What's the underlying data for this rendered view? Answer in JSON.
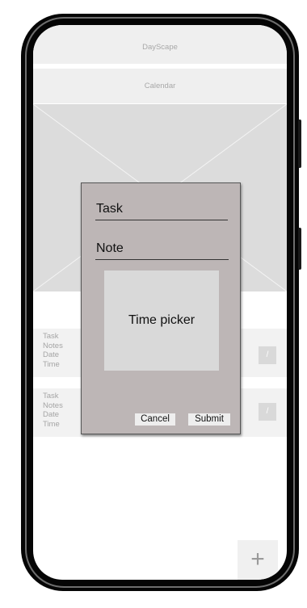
{
  "app": {
    "title": "DayScape",
    "calendar_label": "Calendar"
  },
  "tasks": [
    {
      "task_label": "Task",
      "notes_label": "Notes",
      "date_label": "Date",
      "time_label": "Time",
      "edit_icon": "/"
    },
    {
      "task_label": "Task",
      "notes_label": "Notes",
      "date_label": "Date",
      "time_label": "Time",
      "edit_icon": "/"
    }
  ],
  "fab": {
    "label": "+",
    "icon": "plus-icon"
  },
  "dialog": {
    "task_label": "Task",
    "note_label": "Note",
    "time_picker_label": "Time picker",
    "cancel_label": "Cancel",
    "submit_label": "Submit"
  },
  "colors": {
    "dialog_bg": "#bdb6b6",
    "placeholder_bg": "#dcdcdc",
    "bar_bg": "#efefef",
    "phone_frame": "#050505"
  }
}
